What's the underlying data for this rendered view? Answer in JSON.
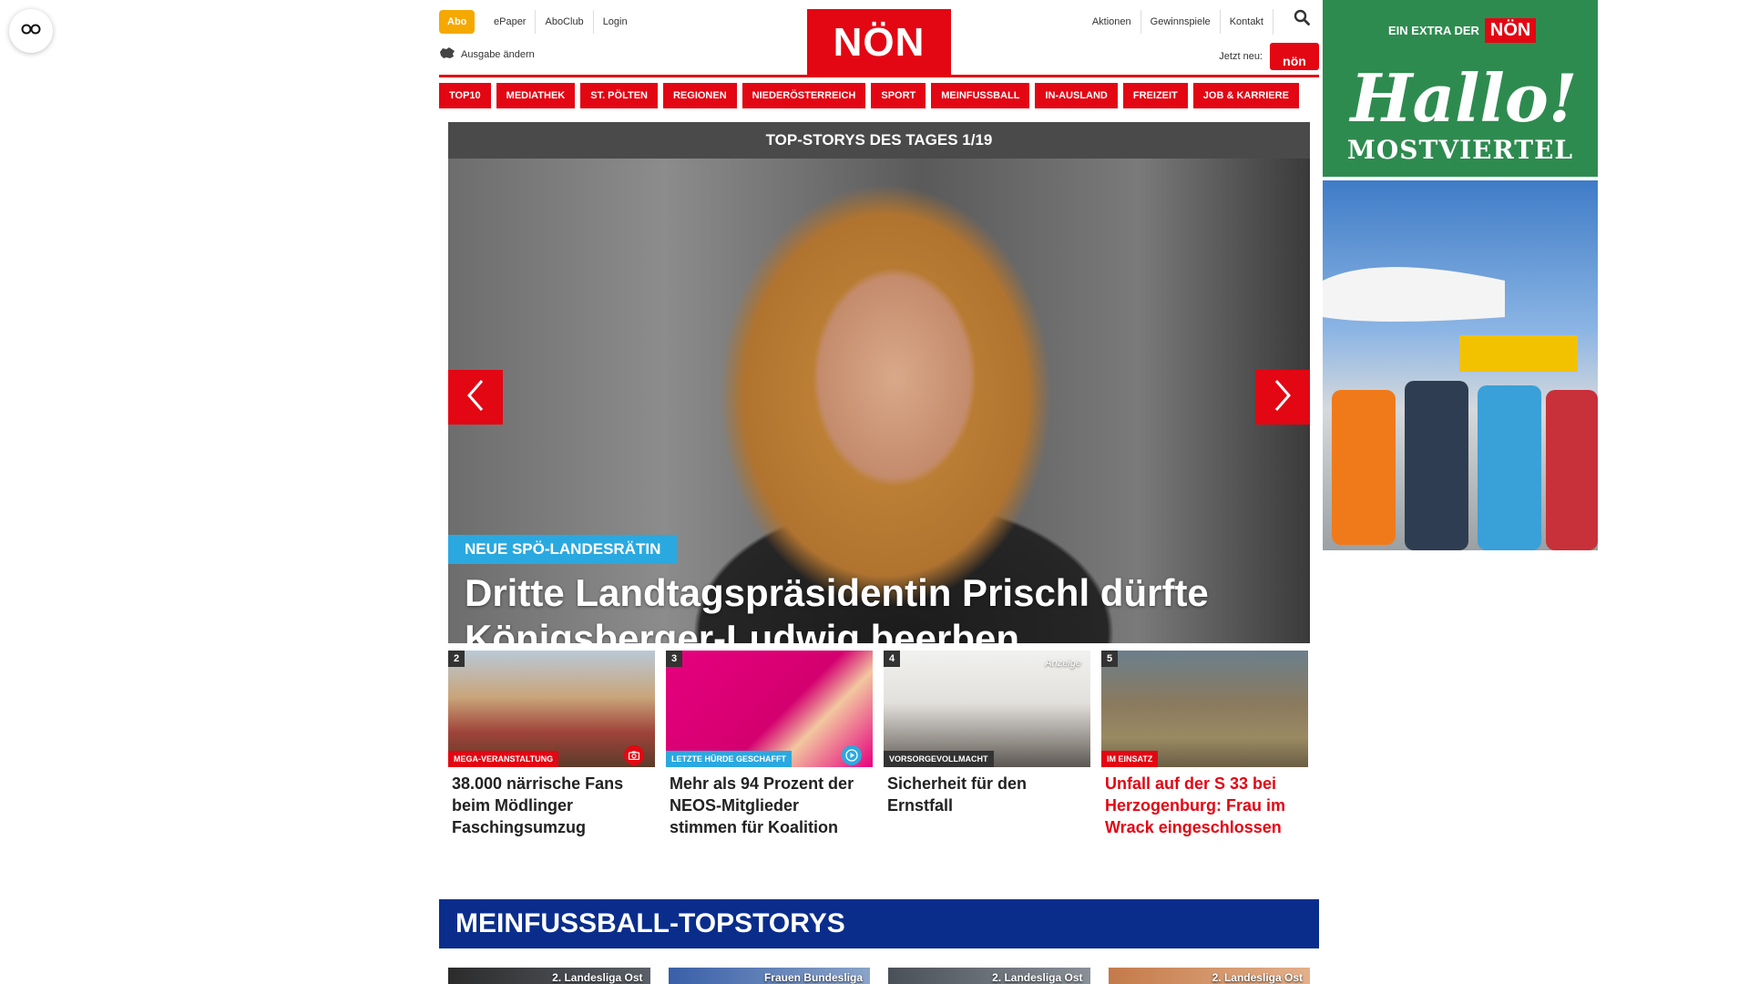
{
  "header": {
    "abo_label": "Abo",
    "top_links": [
      "ePaper",
      "AboClub",
      "Login"
    ],
    "ausgabe_label": "Ausgabe ändern",
    "logo_text": "NÖN",
    "right_links": [
      "Aktionen",
      "Gewinnspiele",
      "Kontakt"
    ],
    "jetzt_neu_label": "Jetzt neu:",
    "jetzt_neu_badge": "nön"
  },
  "nav": {
    "items": [
      "TOP10",
      "MEDIATHEK",
      "ST. PÖLTEN",
      "REGIONEN",
      "NIEDERÖSTERREICH",
      "SPORT",
      "MEINFUSSBALL",
      "IN-AUSLAND",
      "FREIZEIT",
      "JOB & KARRIERE"
    ]
  },
  "hero": {
    "bar_title": "TOP-STORYS DES TAGES 1/19",
    "tag": "NEUE SPÖ-LANDESRÄTIN",
    "title": "Dritte Landtagspräsidentin Prischl dürfte Königsberger-Ludwig beerben"
  },
  "teasers": [
    {
      "number": "2",
      "category": "MEGA-VERANSTALTUNG",
      "category_color": "#e30613",
      "icon": "camera-icon",
      "title": "38.000 närrische Fans beim Mödlinger Faschingsumzug",
      "title_color": "#222222"
    },
    {
      "number": "3",
      "category": "LETZTE HÜRDE GESCHAFFT",
      "category_color": "#2aa9e0",
      "icon": "play-icon",
      "title": "Mehr als 94 Prozent der NEOS-Mitglieder stimmen für Koalition",
      "title_color": "#222222"
    },
    {
      "number": "4",
      "category": "VORSORGEVOLLMACHT",
      "category_color": "#333333",
      "ad_label": "Anzeige",
      "title": "Sicherheit für den Ernstfall",
      "title_color": "#222222"
    },
    {
      "number": "5",
      "category": "IM EINSATZ",
      "category_color": "#e30613",
      "title": "Unfall auf der S 33 bei Herzogenburg: Frau im Wrack eingeschlossen",
      "title_color": "#e30613"
    }
  ],
  "meinfussball": {
    "title": "MEINFUSSBALL-TOPSTORYS",
    "items": [
      "2. Landesliga Ost",
      "Frauen Bundesliga",
      "2. Landesliga Ost",
      "2. Landesliga Ost"
    ]
  },
  "ad": {
    "extra_label": "EIN EXTRA DER",
    "extra_brand": "NÖN",
    "hallo": "Hallo!",
    "region": "MOSTVIERTEL"
  },
  "colors": {
    "brand_red": "#e30613",
    "abo_orange": "#f5a800",
    "tag_blue": "#2aa9e0",
    "fussball_blue": "#0a2d8c",
    "ad_green": "#2e8b4f"
  }
}
